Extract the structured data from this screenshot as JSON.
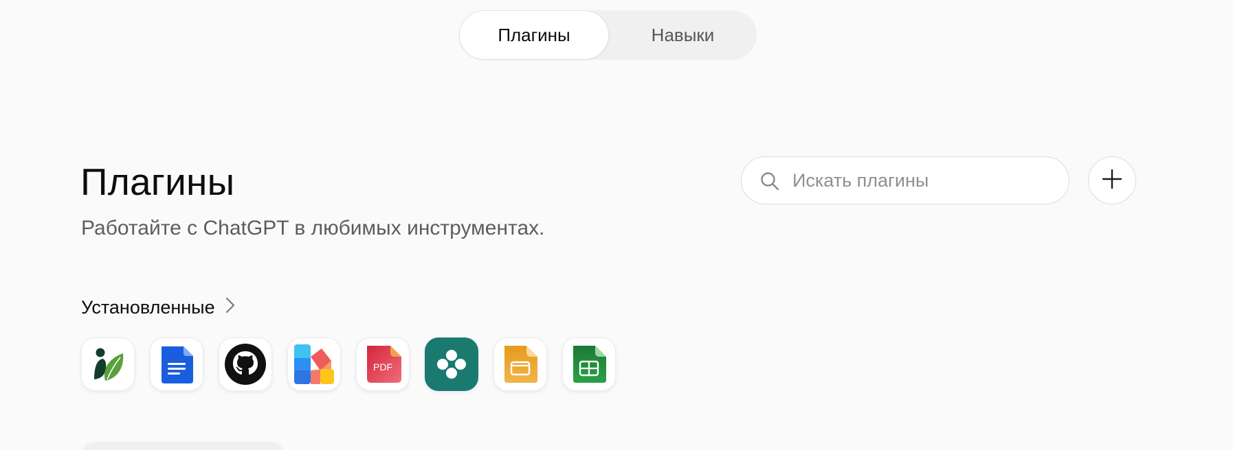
{
  "tabs": {
    "plugins": "Плагины",
    "skills": "Навыки"
  },
  "header": {
    "title": "Плагины",
    "subtitle": "Работайте с ChatGPT в любимых инструментах."
  },
  "search": {
    "placeholder": "Искать плагины",
    "value": ""
  },
  "installed": {
    "label": "Установленные",
    "apps": [
      {
        "name": "plant-app",
        "icon": "leaf-person-icon"
      },
      {
        "name": "google-docs",
        "icon": "docs-icon"
      },
      {
        "name": "github",
        "icon": "github-icon"
      },
      {
        "name": "colorful-app",
        "icon": "shapes-icon"
      },
      {
        "name": "pdf-app",
        "icon": "pdf-icon",
        "text": "PDF"
      },
      {
        "name": "teal-app",
        "icon": "flower-icon"
      },
      {
        "name": "slides",
        "icon": "slides-icon"
      },
      {
        "name": "sheets",
        "icon": "sheets-icon"
      }
    ]
  },
  "colors": {
    "background": "#fafafa",
    "teal": "#1a7a70",
    "docs_blue": "#1a5ee0",
    "sheets_green": "#1e8a3b",
    "slides_orange": "#e8a230"
  }
}
